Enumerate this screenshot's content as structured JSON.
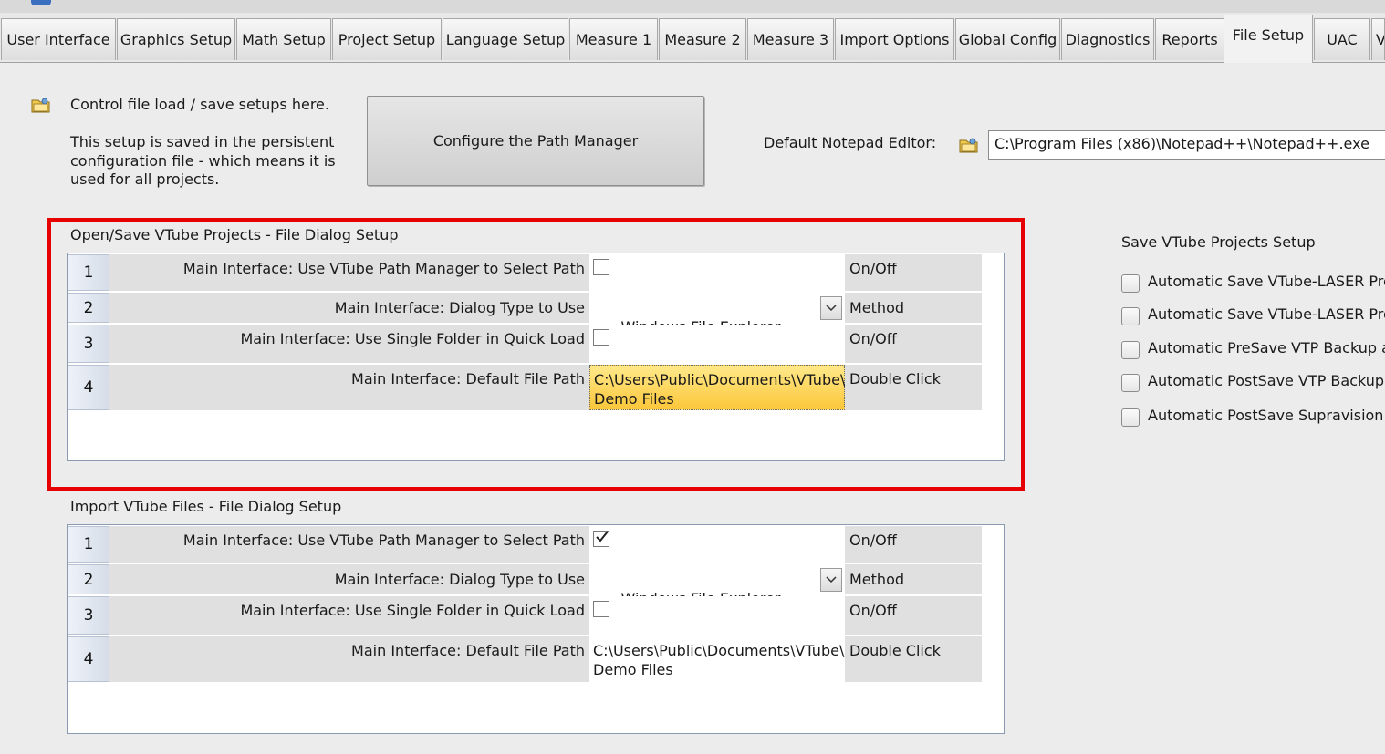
{
  "tabs": [
    {
      "label": "User Interface"
    },
    {
      "label": "Graphics Setup"
    },
    {
      "label": "Math Setup"
    },
    {
      "label": "Project Setup"
    },
    {
      "label": "Language Setup"
    },
    {
      "label": "Measure 1"
    },
    {
      "label": "Measure 2"
    },
    {
      "label": "Measure 3"
    },
    {
      "label": "Import Options"
    },
    {
      "label": "Global Config"
    },
    {
      "label": "Diagnostics"
    },
    {
      "label": "Reports"
    },
    {
      "label": "File Setup"
    },
    {
      "label": "UAC"
    },
    {
      "label": "V"
    }
  ],
  "header": {
    "control_text": "Control file load / save setups here.",
    "persist_line1": "This setup is saved in the persistent",
    "persist_line2": "configuration file - which means it is",
    "persist_line3": "used for all projects.",
    "path_button": "Configure the Path Manager",
    "notepad_label": "Default Notepad Editor:",
    "notepad_value": "C:\\Program Files (x86)\\Notepad++\\Notepad++.exe"
  },
  "open_save": {
    "title": "Open/Save VTube Projects - File Dialog Setup",
    "rows": [
      {
        "num": "1",
        "label": "Main Interface: Use VTube Path Manager to Select Path",
        "checked": false,
        "hint": "On/Off"
      },
      {
        "num": "2",
        "label": "Main Interface: Dialog Type to Use",
        "value": "Windows File Explorer",
        "hint": "Method"
      },
      {
        "num": "3",
        "label": "Main Interface: Use Single Folder in Quick Load",
        "checked": false,
        "hint": "On/Off"
      },
      {
        "num": "4",
        "label": "Main Interface: Default File Path",
        "value_line1": "C:\\Users\\Public\\Documents\\VTube\\",
        "value_line2": "Demo Files",
        "hint": "Double Click"
      }
    ]
  },
  "import": {
    "title": "Import VTube Files - File Dialog Setup",
    "rows": [
      {
        "num": "1",
        "label": "Main Interface: Use VTube Path Manager to Select Path",
        "checked": true,
        "hint": "On/Off"
      },
      {
        "num": "2",
        "label": "Main Interface: Dialog Type to Use",
        "value": "Windows File Explorer",
        "hint": "Method"
      },
      {
        "num": "3",
        "label": "Main Interface: Use Single Folder in Quick Load",
        "checked": false,
        "hint": "On/Off"
      },
      {
        "num": "4",
        "label": "Main Interface: Default File Path",
        "value_line1": "C:\\Users\\Public\\Documents\\VTube\\",
        "value_line2": "Demo Files",
        "hint": "Double Click"
      }
    ]
  },
  "save_setup": {
    "title": "Save VTube Projects Setup",
    "items": [
      {
        "label": "Automatic Save VTube-LASER Proje",
        "checked": false
      },
      {
        "label": "Automatic Save VTube-LASER Proje",
        "checked": false
      },
      {
        "label": "Automatic PreSave VTP Backup at V",
        "checked": false
      },
      {
        "label": "Automatic PostSave VTP Backup at",
        "checked": false
      },
      {
        "label": "Automatic PostSave Supravision Ba",
        "checked": false
      }
    ]
  },
  "colors": {
    "highlight_border": "#e60000",
    "selected_cell": "#fcc73a",
    "window_bg": "#ececec"
  },
  "icons": {
    "folder": "folder-icon",
    "dropdown": "chevron-down-icon",
    "check": "checkmark-icon"
  }
}
